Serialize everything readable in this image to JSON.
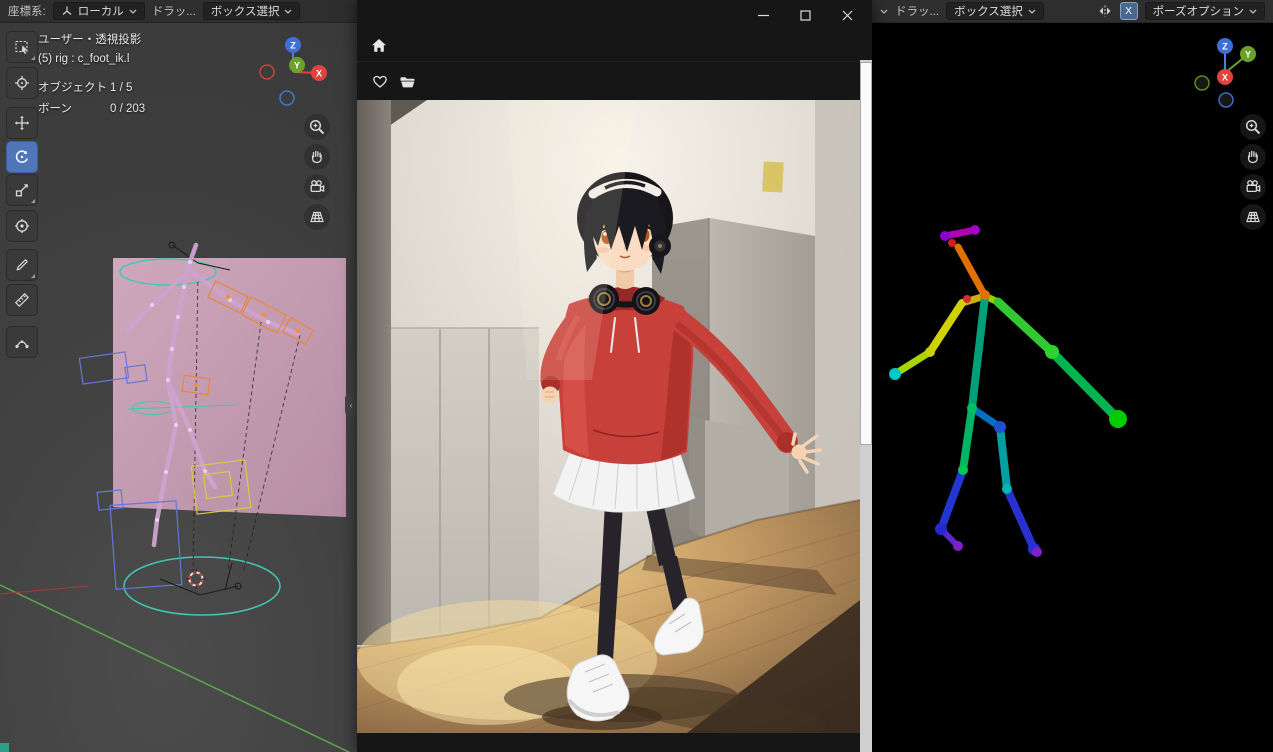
{
  "left_viewport": {
    "header": {
      "coord_label": "座標系:",
      "coord_value": "ローカル",
      "drag_label": "ドラッ...",
      "select_value": "ボックス選択"
    },
    "overlay": {
      "view_mode": "ユーザー・透視投影",
      "active_item": "(5) rig : c_foot_ik.l",
      "object_label": "オブジェクト",
      "object_count": "1 / 5",
      "bone_label": "ボーン",
      "bone_count": "0 / 203"
    }
  },
  "right_viewport": {
    "header": {
      "drag_label": "ドラッ...",
      "select_value": "ボックス選択",
      "mirror_x": "X",
      "pose_options": "ポーズオプション"
    }
  },
  "gizmo": {
    "x": "X",
    "y": "Y",
    "z": "Z"
  },
  "toolbar": {
    "active_tool": "rotate",
    "tools": [
      "select-box",
      "cursor",
      "move",
      "rotate",
      "scale",
      "transform",
      "annotate",
      "measure",
      "pose-breakdowner"
    ]
  },
  "icons": {
    "nav": [
      "zoom-icon",
      "pan-hand-icon",
      "camera-view-icon",
      "grid-floor-icon"
    ],
    "window": [
      "home-icon",
      "heart-icon",
      "folder-icon",
      "minimize-icon",
      "maximize-icon",
      "close-icon"
    ],
    "header": [
      "orientation-axes-icon",
      "chevron-down-icon",
      "mirror-x-icon"
    ]
  },
  "colors": {
    "active_tool": "#4f76b8",
    "axis_x": "#e0433d",
    "axis_y": "#6ba32a",
    "axis_z": "#3e6fd6",
    "selection_teal": "#3fc8b4",
    "plane_pink": "#c7a0b5",
    "hoodie_red": "#c8403a"
  }
}
